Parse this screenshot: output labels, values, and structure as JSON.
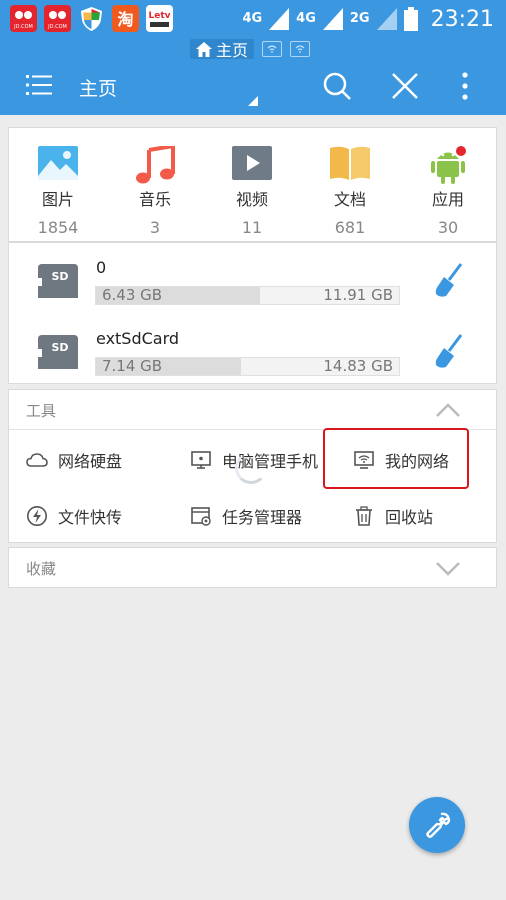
{
  "status_bar": {
    "apps": [
      {
        "name": "jd-icon",
        "text": "JD.COM",
        "color": "#e4252d"
      },
      {
        "name": "jd-icon",
        "text": "JD.COM",
        "color": "#e4252d"
      },
      {
        "name": "shield-icon",
        "text": "",
        "color": "#2aa53c"
      },
      {
        "name": "taobao-icon",
        "text": "淘",
        "color": "#f05a1e"
      },
      {
        "name": "letv-icon",
        "text": "Letv",
        "color": "#ffffff"
      }
    ],
    "net1": "4G",
    "net2": "4G",
    "net3": "2G",
    "time": "23:21"
  },
  "tabs": {
    "home_label": "主页"
  },
  "appbar": {
    "title": "主页"
  },
  "categories": [
    {
      "label": "图片",
      "count": "1854",
      "icon": "image-icon",
      "color": "#4bb3ec"
    },
    {
      "label": "音乐",
      "count": "3",
      "icon": "music-note-icon",
      "color": "#f35a4a"
    },
    {
      "label": "视频",
      "count": "11",
      "icon": "video-play-icon",
      "color": "#6f7c87"
    },
    {
      "label": "文档",
      "count": "681",
      "icon": "book-icon",
      "color": "#f2b94a"
    },
    {
      "label": "应用",
      "count": "30",
      "icon": "android-icon",
      "color": "#8bc34a"
    }
  ],
  "storage": [
    {
      "name": "0",
      "used": "6.43 GB",
      "total": "11.91 GB",
      "fraction": 0.54
    },
    {
      "name": "extSdCard",
      "used": "7.14 GB",
      "total": "14.83 GB",
      "fraction": 0.48
    }
  ],
  "sd_label": "SD",
  "tools": {
    "header": "工具",
    "items": [
      {
        "label": "网络硬盘",
        "icon": "cloud-icon"
      },
      {
        "label": "电脑管理手机",
        "icon": "monitor-icon"
      },
      {
        "label": "我的网络",
        "icon": "wifi-monitor-icon"
      },
      {
        "label": "文件快传",
        "icon": "lightning-icon"
      },
      {
        "label": "任务管理器",
        "icon": "task-manager-icon"
      },
      {
        "label": "回收站",
        "icon": "trash-icon"
      }
    ]
  },
  "favorites": {
    "header": "收藏"
  },
  "colors": {
    "primary": "#3a97e0",
    "highlight": "#d8161c"
  }
}
